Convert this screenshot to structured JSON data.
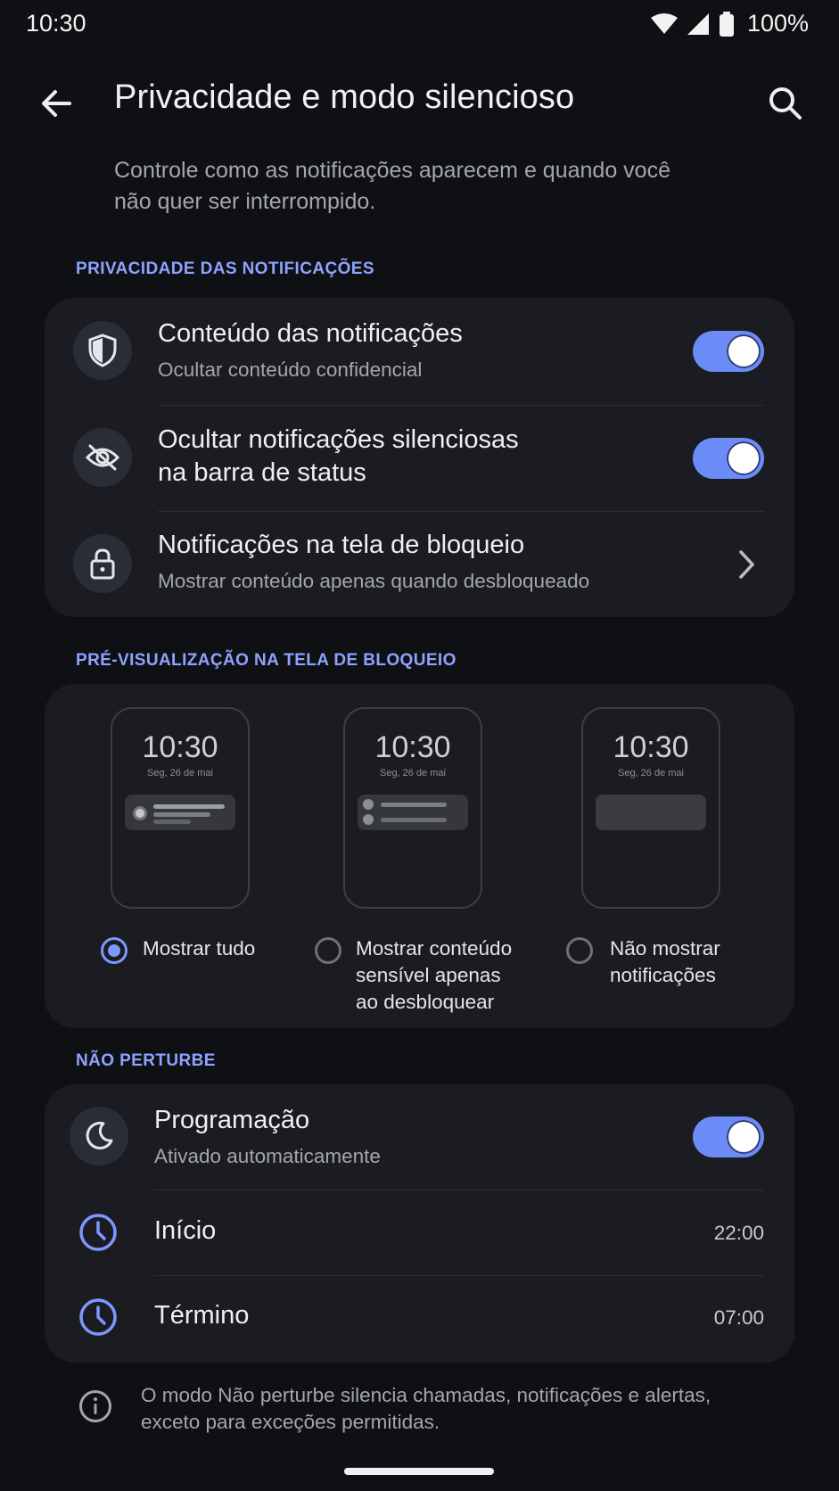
{
  "status_bar": {
    "time": "10:30",
    "battery": "100%"
  },
  "app_bar": {
    "title": "Privacidade e modo silencioso"
  },
  "subtitle": "Controle como as notificações aparecem e quando você não quer ser interrompido.",
  "privacy_section": {
    "header": "PRIVACIDADE DAS NOTIFICAÇÕES",
    "items": [
      {
        "title": "Conteúdo das notificações",
        "subtitle": "Ocultar conteúdo confidencial",
        "icon": "shield-icon",
        "toggle_on": true
      },
      {
        "title": "Ocultar notificações silenciosas\nna barra de status",
        "subtitle": "",
        "icon": "eye-off-icon",
        "toggle_on": true
      },
      {
        "title": "Notificações na tela de bloqueio",
        "subtitle": "Mostrar conteúdo apenas quando desbloqueado",
        "icon": "lock-icon",
        "chevron": true
      }
    ]
  },
  "lockscreen_section": {
    "header": "PRÉ-VISUALIZAÇÃO NA TELA DE BLOQUEIO",
    "options": [
      {
        "time": "10:30",
        "date": "Seg, 26 de mai",
        "label": "Mostrar tudo",
        "selected": true
      },
      {
        "time": "10:30",
        "date": "Seg, 26 de mai",
        "label": "Mostrar conteúdo\nsensível apenas\nao desbloquear",
        "selected": false
      },
      {
        "time": "10:30",
        "date": "Seg, 26 de mai",
        "label": "Não mostrar\nnotificações",
        "selected": false
      }
    ]
  },
  "dnd_section": {
    "header": "NÃO PERTURBE",
    "schedule": {
      "title": "Programação",
      "subtitle": "Ativado automaticamente",
      "icon": "moon-icon",
      "toggle_on": true
    },
    "start": {
      "label": "Início",
      "value": "22:00",
      "icon": "clock-icon"
    },
    "end": {
      "label": "Término",
      "value": "07:00",
      "icon": "clock-icon"
    }
  },
  "footer_note": "O modo Não perturbe silencia chamadas, notificações e alertas, exceto para exceções permitidas.",
  "colors": {
    "accent": "#6b8cf6",
    "background": "#0f1013",
    "card": "#1b1c21",
    "section_header": "#8da3ff"
  }
}
